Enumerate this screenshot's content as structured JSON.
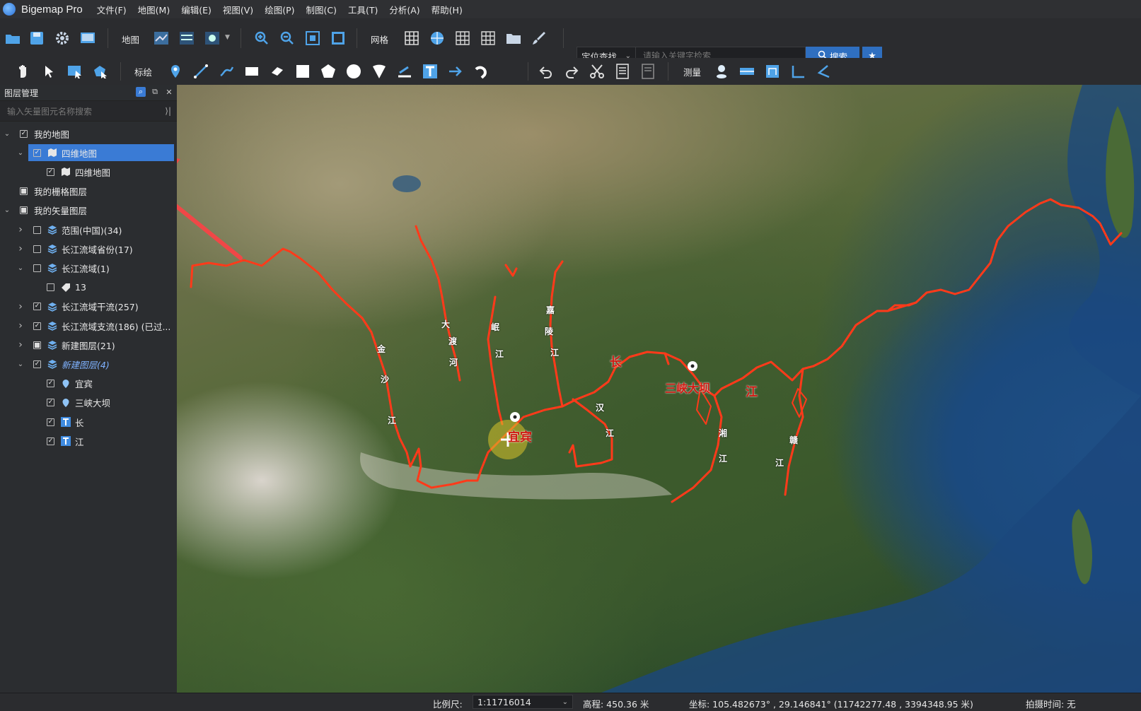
{
  "app": {
    "title": "Bigemap Pro"
  },
  "menu": [
    "文件(F)",
    "地图(M)",
    "编辑(E)",
    "视图(V)",
    "绘图(P)",
    "制图(C)",
    "工具(T)",
    "分析(A)",
    "帮助(H)"
  ],
  "toolbar1": {
    "map_label": "地图",
    "grid_label": "网格",
    "search": {
      "mode": "定位查找",
      "placeholder": "请输入关键字检索",
      "button": "搜索"
    }
  },
  "toolbar2": {
    "draw_label": "标绘",
    "measure_label": "测量"
  },
  "layer_panel": {
    "title": "图层管理",
    "search_placeholder": "输入矢量图元名称搜索",
    "tree": [
      {
        "label": "我的地图",
        "level": 0,
        "expanded": true,
        "checked": "checked"
      },
      {
        "label": "四维地图",
        "level": 1,
        "expanded": true,
        "checked": "checked",
        "selected": true
      },
      {
        "label": "四维地图",
        "level": 2,
        "checked": "checked"
      },
      {
        "label": "我的栅格图层",
        "level": 0,
        "checked": "partial"
      },
      {
        "label": "我的矢量图层",
        "level": 0,
        "expanded": true,
        "checked": "partial"
      },
      {
        "label": "范围(中国)(34)",
        "level": 1,
        "collapsed": true,
        "checked": "unchecked"
      },
      {
        "label": "长江流域省份(17)",
        "level": 1,
        "collapsed": true,
        "checked": "unchecked"
      },
      {
        "label": "长江流域(1)",
        "level": 1,
        "expanded": true,
        "checked": "unchecked"
      },
      {
        "label": "13",
        "level": 2,
        "checked": "unchecked"
      },
      {
        "label": "长江流域干流(257)",
        "level": 1,
        "collapsed": true,
        "checked": "checked"
      },
      {
        "label": "长江流域支流(186) (已过...",
        "level": 1,
        "collapsed": true,
        "checked": "checked"
      },
      {
        "label": "新建图层(21)",
        "level": 1,
        "collapsed": true,
        "checked": "partial"
      },
      {
        "label": "新建图层(4)",
        "level": 1,
        "expanded": true,
        "checked": "checked",
        "italic": true
      },
      {
        "label": "宜宾",
        "level": 2,
        "checked": "checked"
      },
      {
        "label": "三峡大坝",
        "level": 2,
        "checked": "checked"
      },
      {
        "label": "长",
        "level": 2,
        "checked": "checked"
      },
      {
        "label": "江",
        "level": 2,
        "checked": "checked"
      }
    ]
  },
  "map": {
    "labels": {
      "jinsha": [
        "金",
        "沙",
        "江"
      ],
      "dadu": [
        "大",
        "渡",
        "河"
      ],
      "min": [
        "岷",
        "江"
      ],
      "jialing": [
        "嘉",
        "陵",
        "江"
      ],
      "han": [
        "汉",
        "江"
      ],
      "xiang": [
        "湘",
        "江"
      ],
      "gan": [
        "赣",
        "江"
      ],
      "yibin": "宜宾",
      "sanxia": "三峡大坝",
      "chang": "长",
      "jiang": "江"
    },
    "river_color": "#ff3a1a"
  },
  "status": {
    "scale_label": "比例尺:",
    "scale_value": "1:11716014",
    "elevation": "高程: 450.36 米",
    "coords": "坐标: 105.482673° , 29.146841°  (11742277.48 , 3394348.95 米)",
    "capture_time": "拍摄时间: 无"
  }
}
